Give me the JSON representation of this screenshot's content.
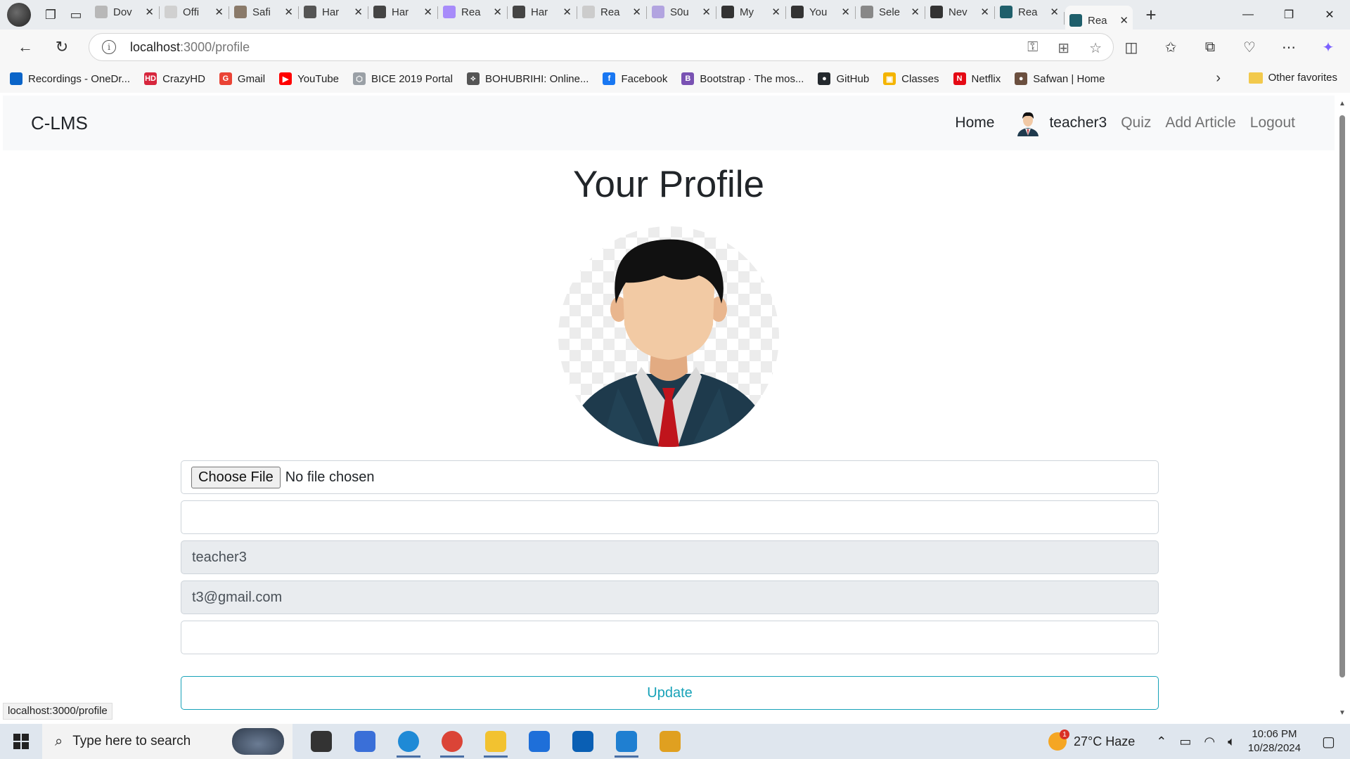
{
  "browser": {
    "tabs": [
      {
        "title": "Dov",
        "color": "#b8b8b8"
      },
      {
        "title": "Offi",
        "color": "#d0d0d0"
      },
      {
        "title": "Safi",
        "color": "#8a7a6a"
      },
      {
        "title": "Har",
        "color": "#555555"
      },
      {
        "title": "Har",
        "color": "#444444"
      },
      {
        "title": "Rea",
        "color": "#a78bfa"
      },
      {
        "title": "Har",
        "color": "#444444"
      },
      {
        "title": "Rea",
        "color": "#cccccc"
      },
      {
        "title": "S0u",
        "color": "#b2a4e0"
      },
      {
        "title": "My",
        "color": "#333333"
      },
      {
        "title": "You",
        "color": "#333333"
      },
      {
        "title": "Sele",
        "color": "#888888"
      },
      {
        "title": "Nev",
        "color": "#333333"
      },
      {
        "title": "Rea",
        "color": "#1f5f6b"
      },
      {
        "title": "Rea",
        "color": "#1f5f6b"
      }
    ],
    "url_host": "localhost",
    "url_path": ":3000/profile"
  },
  "bookmarks": [
    {
      "label": "Recordings - OneDr...",
      "color": "#0a64c8",
      "glyph": ""
    },
    {
      "label": "CrazyHD",
      "color": "#d7263d",
      "glyph": "HD"
    },
    {
      "label": "Gmail",
      "color": "#ea4335",
      "glyph": "G"
    },
    {
      "label": "YouTube",
      "color": "#ff0000",
      "glyph": "▶"
    },
    {
      "label": "BICE 2019 Portal",
      "color": "#9aa0a6",
      "glyph": "⬡"
    },
    {
      "label": "BOHUBRIHI: Online...",
      "color": "#555555",
      "glyph": "⟡"
    },
    {
      "label": "Facebook",
      "color": "#1877f2",
      "glyph": "f"
    },
    {
      "label": "Bootstrap · The mos...",
      "color": "#7952b3",
      "glyph": "B"
    },
    {
      "label": "GitHub",
      "color": "#24292e",
      "glyph": "●"
    },
    {
      "label": "Classes",
      "color": "#f4b400",
      "glyph": "▣"
    },
    {
      "label": "Netflix",
      "color": "#e50914",
      "glyph": "N"
    },
    {
      "label": "Safwan | Home",
      "color": "#6b4f3f",
      "glyph": "●"
    }
  ],
  "bookmarks_other": "Other favorites",
  "app": {
    "brand": "C-LMS",
    "nav": {
      "home": "Home",
      "username": "teacher3",
      "quiz": "Quiz",
      "add_article": "Add Article",
      "logout": "Logout"
    },
    "page_title": "Your Profile",
    "form": {
      "file_button": "Choose File",
      "file_status": "No file chosen",
      "field_blank_1": "",
      "username_value": "teacher3",
      "email_value": "t3@gmail.com",
      "field_blank_2": "",
      "update_label": "Update"
    },
    "accent_color": "#17a2b8"
  },
  "status_bar": "localhost:3000/profile",
  "taskbar": {
    "search_placeholder": "Type here to search",
    "weather": "27°C  Haze",
    "weather_badge": "1",
    "time": "10:06 PM",
    "date": "10/28/2024",
    "apps": [
      {
        "name": "task-view",
        "color": "#333333",
        "open": false
      },
      {
        "name": "pc-app",
        "color": "#3a6fd8",
        "open": false
      },
      {
        "name": "edge",
        "color": "#1f8ad6",
        "open": true
      },
      {
        "name": "chrome",
        "color": "#db4437",
        "open": true
      },
      {
        "name": "file-explorer",
        "color": "#f2c230",
        "open": true
      },
      {
        "name": "store",
        "color": "#1e6fd9",
        "open": false
      },
      {
        "name": "outlook",
        "color": "#0a5fb4",
        "open": false
      },
      {
        "name": "vscode",
        "color": "#1f7fd1",
        "open": true
      },
      {
        "name": "snipping-tool",
        "color": "#e0a020",
        "open": false
      }
    ]
  }
}
